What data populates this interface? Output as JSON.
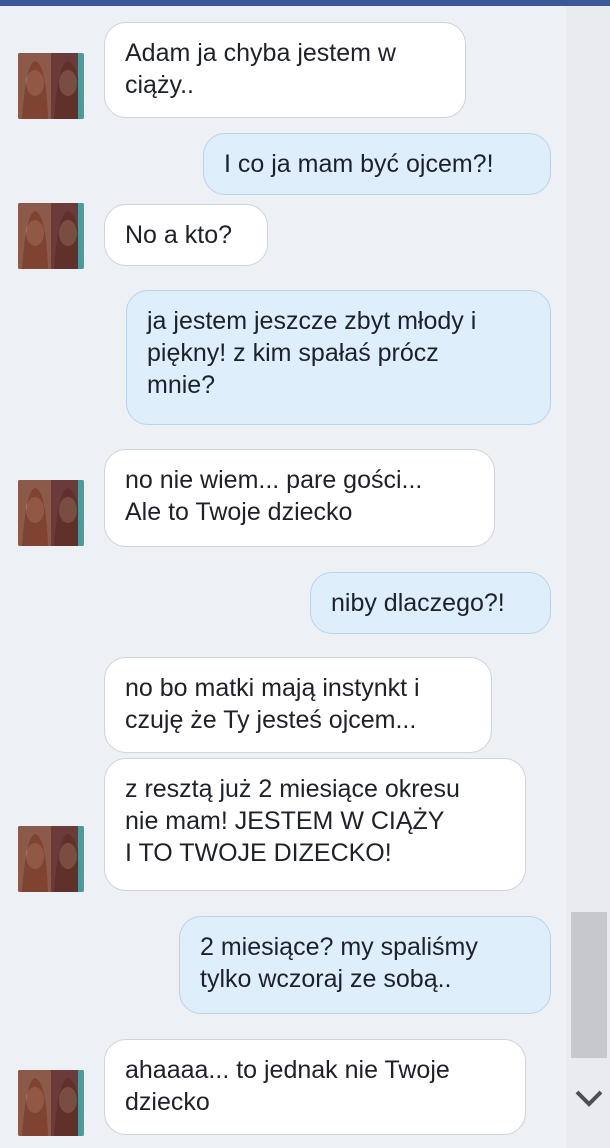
{
  "messages": [
    {
      "id": 1,
      "from": "other",
      "text": "Adam ja chyba jestem w\nciąży.."
    },
    {
      "id": 2,
      "from": "me",
      "text": "I co ja mam być ojcem?!"
    },
    {
      "id": 3,
      "from": "other",
      "text": "No a kto?"
    },
    {
      "id": 4,
      "from": "me",
      "text": "ja jestem jeszcze zbyt młody i\npiękny! z kim spałaś prócz\nmnie?"
    },
    {
      "id": 5,
      "from": "other",
      "text": "no nie wiem... pare gości...\nAle to Twoje dziecko"
    },
    {
      "id": 6,
      "from": "me",
      "text": "niby dlaczego?!"
    },
    {
      "id": 7,
      "from": "other",
      "text": "no bo matki mają instynkt i\nczuję że Ty jesteś ojcem..."
    },
    {
      "id": 8,
      "from": "other",
      "text": "z resztą już 2 miesiące okresu\nnie mam! JESTEM W CIĄŻY\nI TO TWOJE DIZECKO!"
    },
    {
      "id": 9,
      "from": "me",
      "text": "2 miesiące? my spaliśmy\ntylko wczoraj ze sobą.."
    },
    {
      "id": 10,
      "from": "other",
      "text": "ahaaaa... to jednak nie Twoje\ndziecko"
    }
  ],
  "icons": {
    "scroll_down": "chevron-down-icon",
    "avatar": "profile-photo"
  },
  "colors": {
    "header": "#3b5998",
    "background": "#edf0f5",
    "incoming_bubble": "#ffffff",
    "outgoing_bubble": "#dfeefb",
    "text": "#1d2129"
  }
}
